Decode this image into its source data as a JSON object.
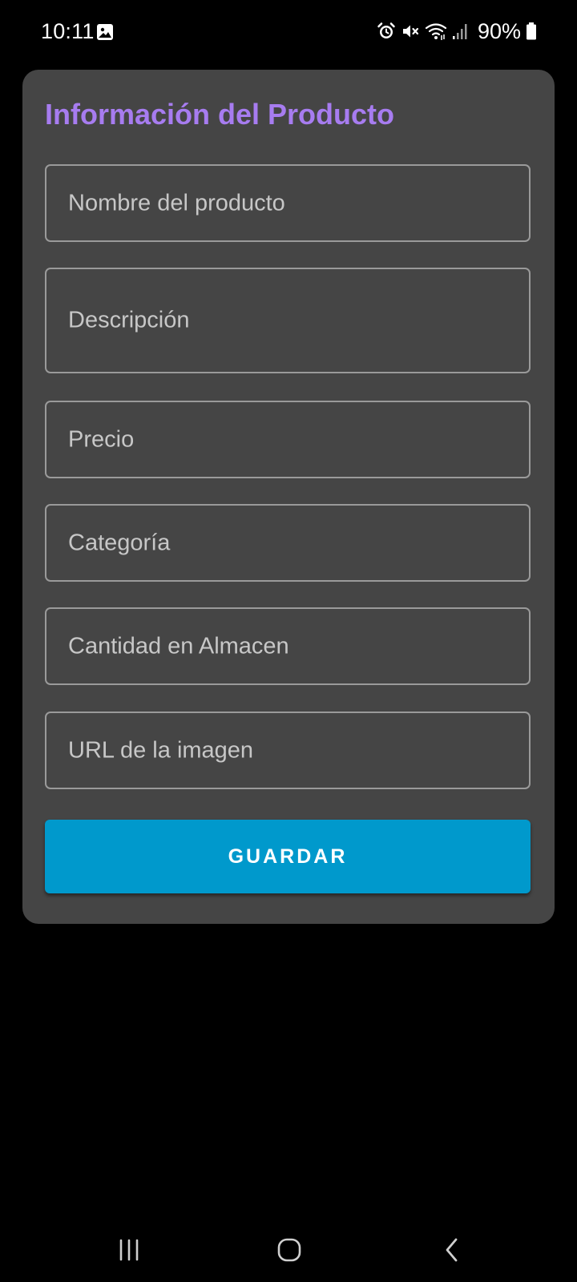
{
  "status_bar": {
    "time": "10:11",
    "battery_percent": "90%",
    "icons": [
      "gallery-icon",
      "alarm-icon",
      "mute-icon",
      "wifi-icon",
      "signal-icon",
      "battery-icon"
    ]
  },
  "form": {
    "title": "Información del Producto",
    "fields": [
      {
        "placeholder": "Nombre del producto",
        "value": ""
      },
      {
        "placeholder": "Descripción",
        "value": ""
      },
      {
        "placeholder": "Precio",
        "value": ""
      },
      {
        "placeholder": "Categoría",
        "value": ""
      },
      {
        "placeholder": "Cantidad en Almacen",
        "value": ""
      },
      {
        "placeholder": "URL de la imagen",
        "value": ""
      }
    ],
    "save_label": "GUARDAR"
  },
  "nav_bar": {
    "icons": [
      "recents-icon",
      "home-icon",
      "back-icon"
    ]
  },
  "colors": {
    "background": "#000000",
    "card": "#454545",
    "title": "#a77cf0",
    "field_border": "#9a9a9a",
    "placeholder_text": "#c7c7c7",
    "button": "#0099cc",
    "button_text": "#ffffff"
  }
}
